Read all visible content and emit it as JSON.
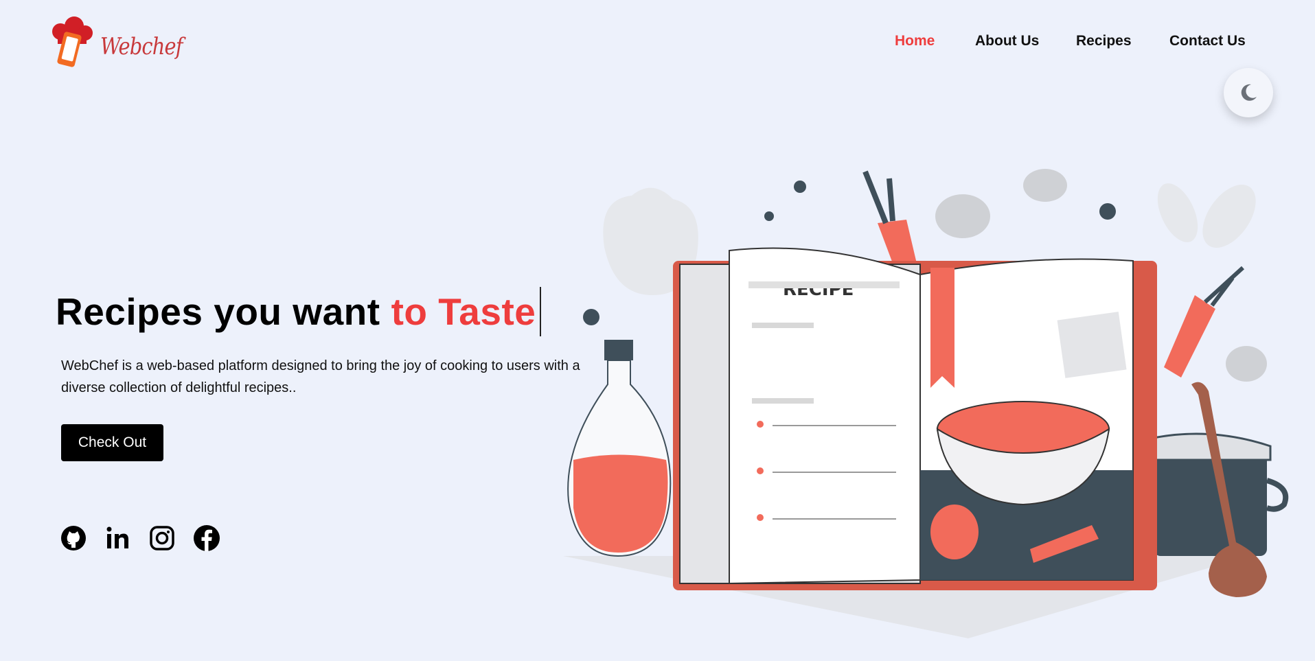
{
  "brand": {
    "logo_text": "Webchef"
  },
  "nav": {
    "items": [
      {
        "label": "Home",
        "active": true
      },
      {
        "label": "About Us",
        "active": false
      },
      {
        "label": "Recipes",
        "active": false
      },
      {
        "label": "Contact Us",
        "active": false
      }
    ]
  },
  "theme_toggle": {
    "icon": "moon-icon"
  },
  "hero": {
    "headline_main": "Recipes you want",
    "headline_accent": "to Taste",
    "description": "WebChef is a web-based platform designed to bring the joy of cooking to users with a diverse collection of delightful recipes..",
    "cta_label": "Check Out"
  },
  "illustration": {
    "book_title": "RECIPE"
  },
  "social": [
    {
      "icon": "github-icon"
    },
    {
      "icon": "linkedin-icon"
    },
    {
      "icon": "instagram-icon"
    },
    {
      "icon": "facebook-icon"
    }
  ],
  "colors": {
    "accent": "#ee3d3d",
    "background": "#edf1fb",
    "button": "#000000",
    "illustration_red": "#f26b5b",
    "illustration_dark": "#3f4f5a"
  }
}
